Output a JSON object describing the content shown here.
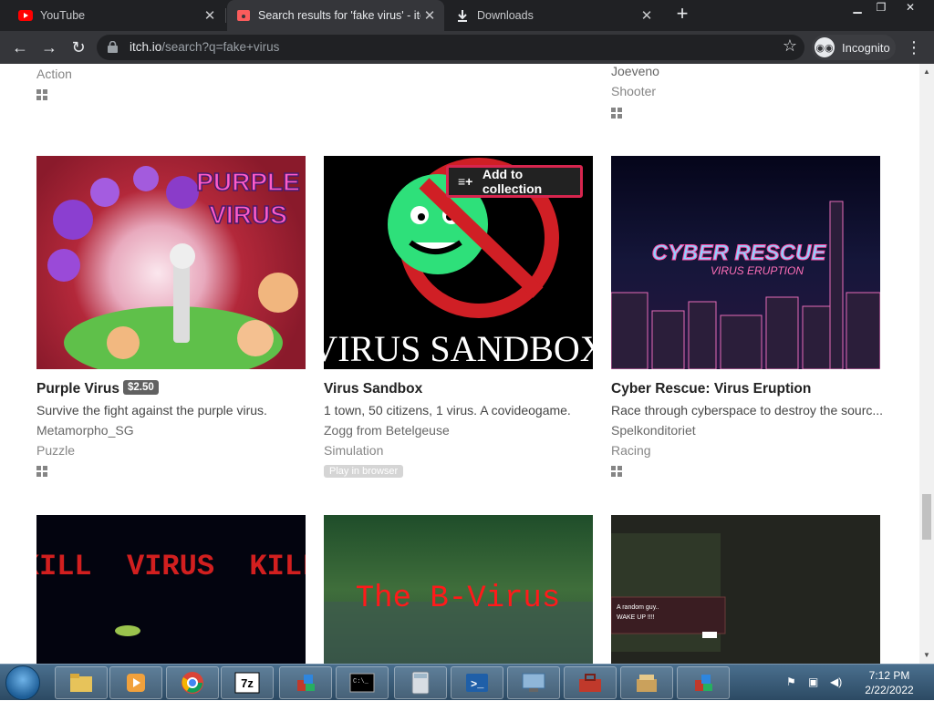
{
  "browser": {
    "tabs": [
      {
        "label": "YouTube",
        "favicon": "youtube-icon"
      },
      {
        "label": "Search results for 'fake virus' - itc",
        "favicon": "itchio-icon"
      },
      {
        "label": "Downloads",
        "favicon": "download-icon"
      }
    ],
    "url_domain": "itch.io",
    "url_path": "/search?q=fake+virus",
    "incognito_label": "Incognito"
  },
  "top_row": [
    {
      "genre": "Action",
      "platform": "windows"
    },
    {
      "author": "Joeveno",
      "genre": "Shooter",
      "platform": "windows"
    }
  ],
  "games": [
    {
      "title": "Purple Virus",
      "price": "$2.50",
      "description": "Survive the fight against the purple virus.",
      "author": "Metamorpho_SG",
      "genre": "Puzzle",
      "platform": "windows",
      "cover_text": [
        "PURPLE",
        "VIRUS"
      ]
    },
    {
      "title": "Virus Sandbox",
      "description": "1 town, 50 citizens, 1 virus. A covideogame.",
      "author": "Zogg from Betelgeuse",
      "genre": "Simulation",
      "badge": "Play in browser",
      "cover_text": [
        "VIRUS SANDBOX"
      ],
      "hover_button": "Add to collection"
    },
    {
      "title": "Cyber Rescue: Virus Eruption",
      "description": "Race through cyberspace to destroy the sourc...",
      "author": "Spelkonditoriet",
      "genre": "Racing",
      "platform": "windows",
      "cover_text": [
        "CYBER RESCUE",
        "VIRUS ERUPTION"
      ]
    }
  ],
  "bottom_row": [
    {
      "cover_text": "KILL  VIRUS  KILL"
    },
    {
      "cover_text": "The B-Virus"
    },
    {
      "cover_text": [
        "A random guy..",
        "WAKE UP !!!!"
      ]
    }
  ],
  "taskbar": {
    "time": "7:12 PM",
    "date": "2/22/2022"
  },
  "colors": {
    "tab_bg": "#202124",
    "toolbar_bg": "#35363a",
    "highlight": "#d7254e",
    "taskbar": "#3a5c78"
  }
}
